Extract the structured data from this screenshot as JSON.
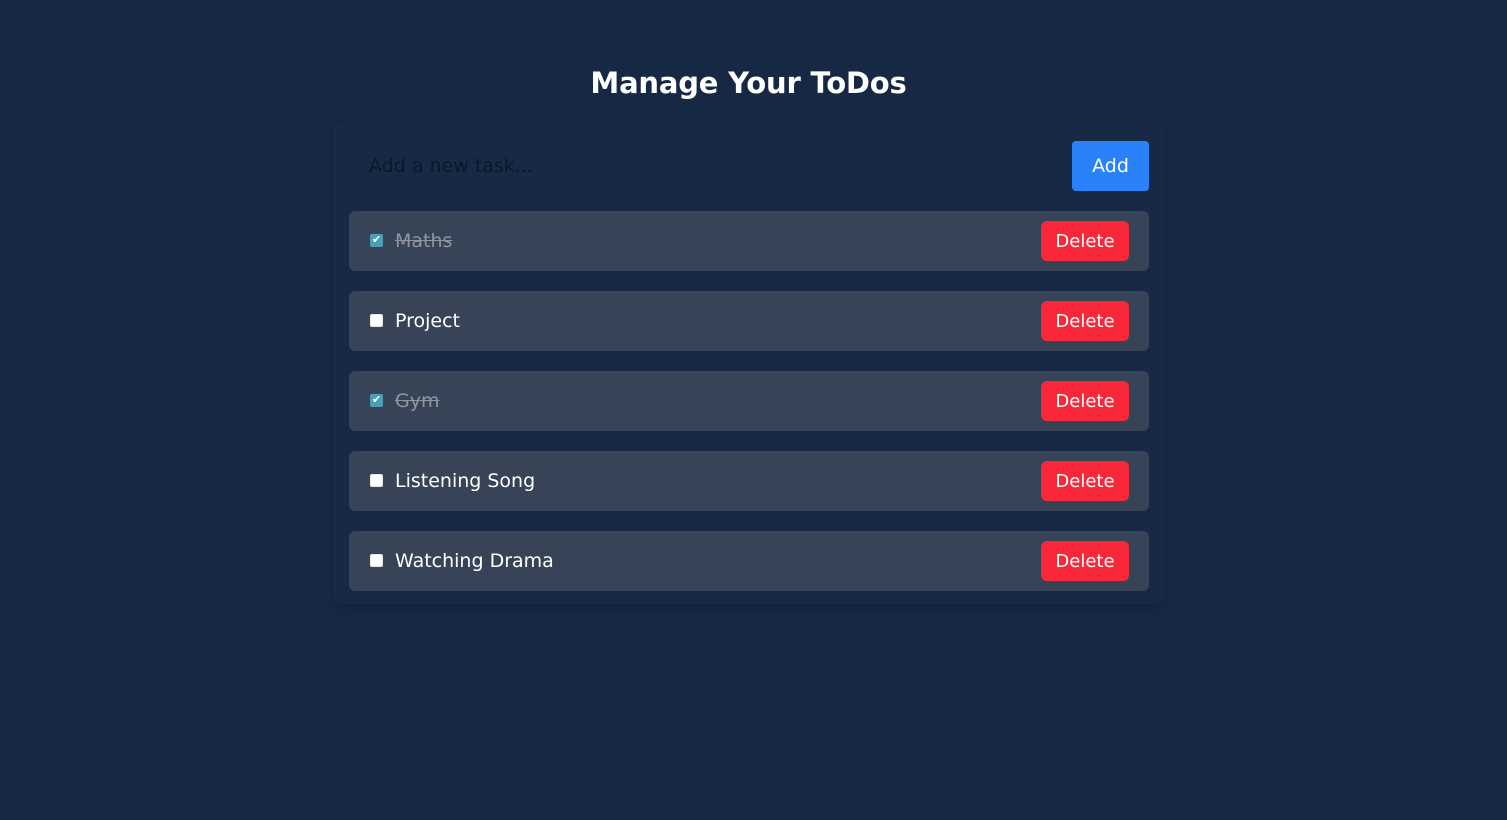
{
  "header": {
    "title": "Manage Your ToDos"
  },
  "new_task": {
    "placeholder": "Add a new task...",
    "value": "",
    "add_label": "Add"
  },
  "tasks": [
    {
      "label": "Maths",
      "completed": true,
      "delete_label": "Delete"
    },
    {
      "label": "Project",
      "completed": false,
      "delete_label": "Delete"
    },
    {
      "label": "Gym",
      "completed": true,
      "delete_label": "Delete"
    },
    {
      "label": "Listening Song",
      "completed": false,
      "delete_label": "Delete"
    },
    {
      "label": "Watching Drama",
      "completed": false,
      "delete_label": "Delete"
    }
  ],
  "colors": {
    "background": "#172844",
    "task_row": "#374356",
    "add_button": "#2a82fb",
    "delete_button": "#f8283a",
    "checked": "#4a9fb5",
    "completed_text": "#8f96a1"
  },
  "icons": {
    "checkbox_checked": "check-icon"
  }
}
